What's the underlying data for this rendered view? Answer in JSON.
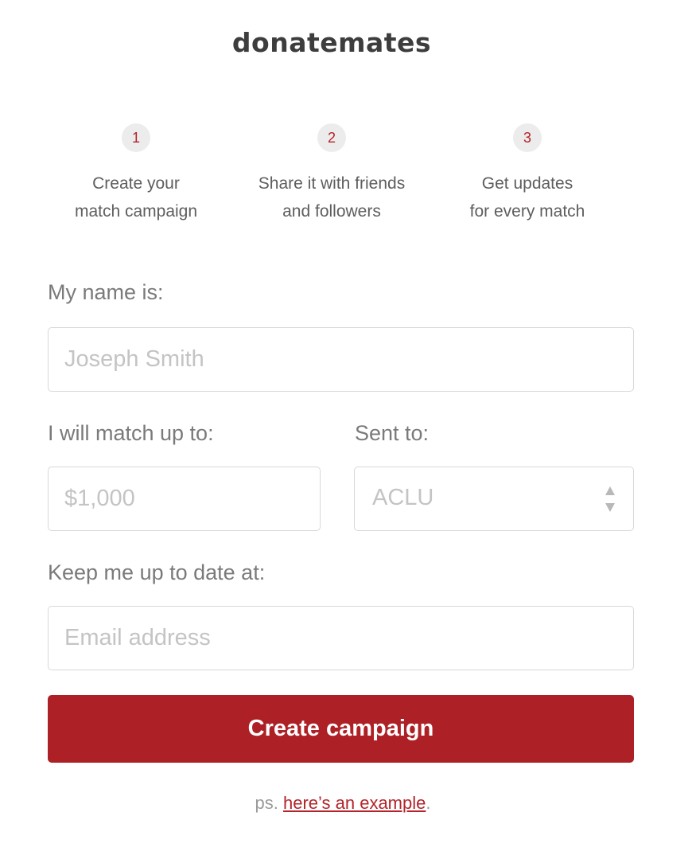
{
  "brand": {
    "name": "donatemates"
  },
  "steps": [
    {
      "number": "1",
      "line1": "Create your",
      "line2": "match campaign"
    },
    {
      "number": "2",
      "line1": "Share it with friends",
      "line2": "and followers"
    },
    {
      "number": "3",
      "line1": "Get updates",
      "line2": "for every match"
    }
  ],
  "form": {
    "name_label": "My name is:",
    "name_placeholder": "Joseph Smith",
    "amount_label": "I will match up to:",
    "amount_placeholder": "$1,000",
    "recipient_label": "Sent to:",
    "recipient_selected": "ACLU",
    "email_label": "Keep me up to date at:",
    "email_placeholder": "Email address",
    "submit_label": "Create campaign"
  },
  "footer": {
    "prefix": "ps. ",
    "link_text": "here’s an example",
    "suffix": "."
  },
  "colors": {
    "accent": "#ad2025",
    "step_circle": "#ececec",
    "text": "#6f6f6f"
  }
}
